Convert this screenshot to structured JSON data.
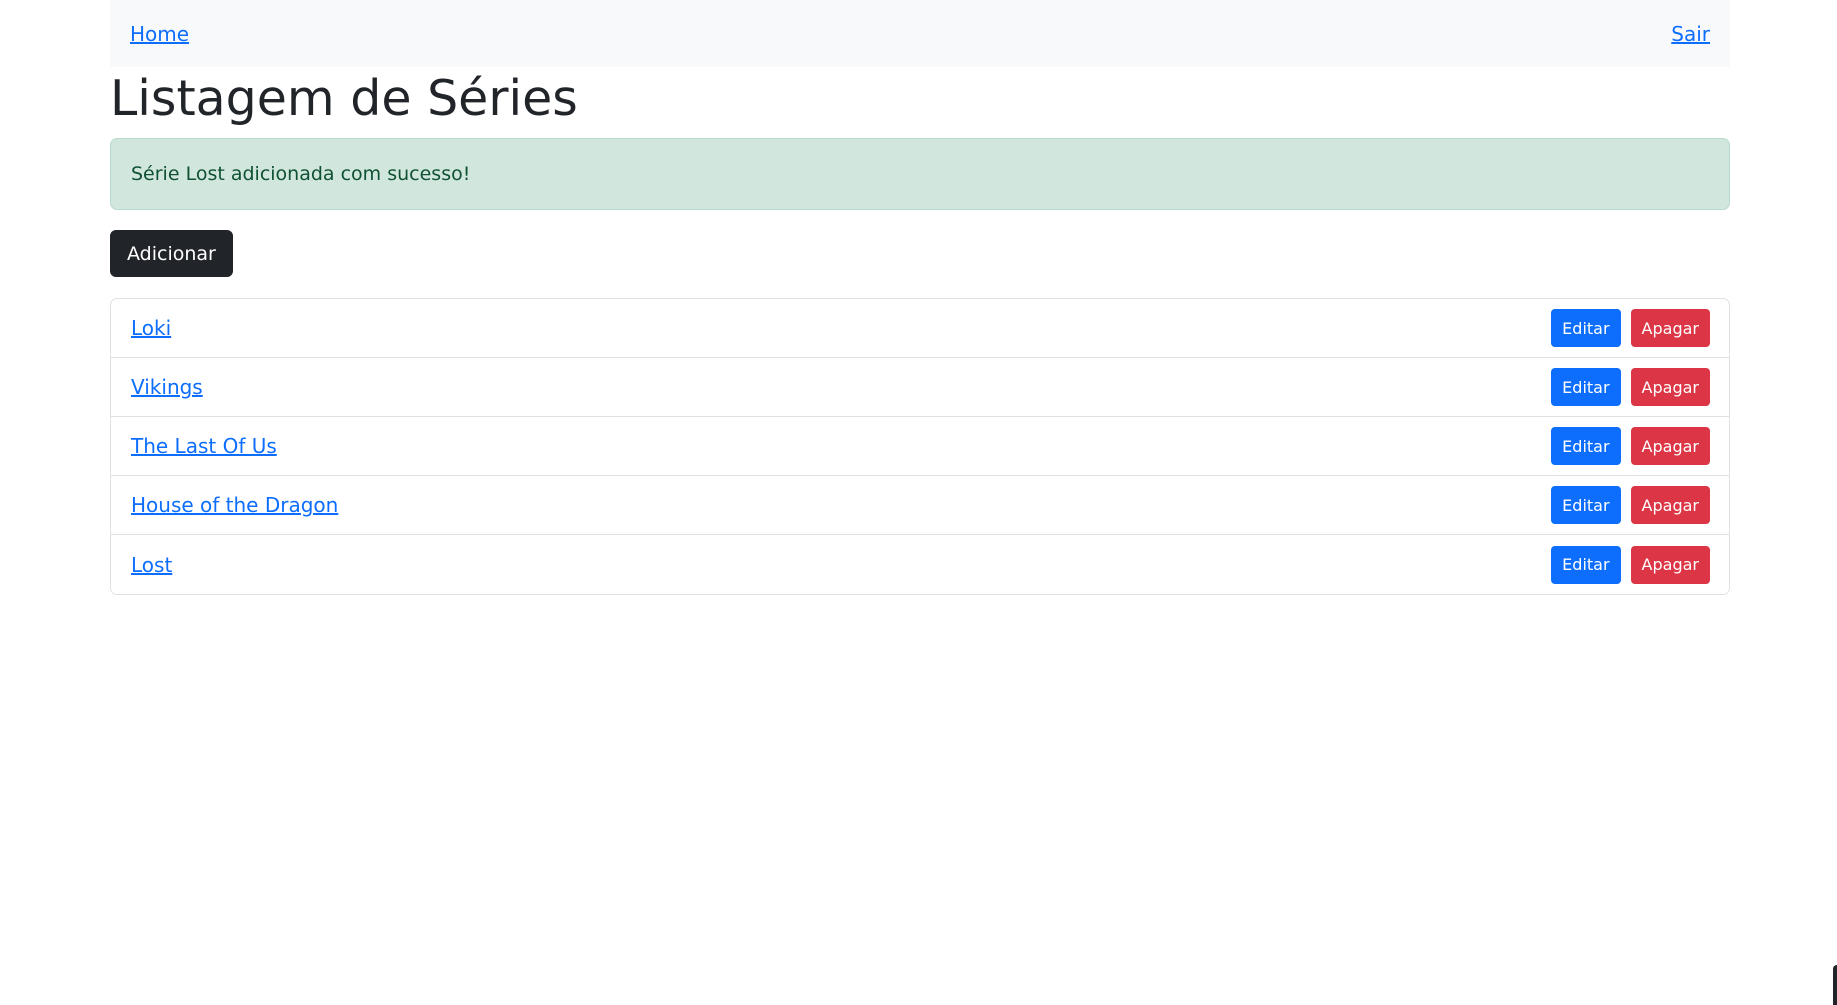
{
  "navbar": {
    "home_label": "Home",
    "logout_label": "Sair"
  },
  "page": {
    "title": "Listagem de Séries"
  },
  "alert": {
    "message": "Série Lost adicionada com sucesso!"
  },
  "toolbar": {
    "add_label": "Adicionar"
  },
  "series": [
    {
      "name": "Loki",
      "edit_label": "Editar",
      "delete_label": "Apagar"
    },
    {
      "name": "Vikings",
      "edit_label": "Editar",
      "delete_label": "Apagar"
    },
    {
      "name": "The Last Of Us",
      "edit_label": "Editar",
      "delete_label": "Apagar"
    },
    {
      "name": "House of the Dragon",
      "edit_label": "Editar",
      "delete_label": "Apagar"
    },
    {
      "name": "Lost",
      "edit_label": "Editar",
      "delete_label": "Apagar"
    }
  ],
  "colors": {
    "primary": "#0d6efd",
    "danger": "#dc3545",
    "dark": "#212529",
    "success_bg": "#d1e7dd",
    "success_text": "#0f5132",
    "navbar_bg": "#f8f9fa"
  }
}
